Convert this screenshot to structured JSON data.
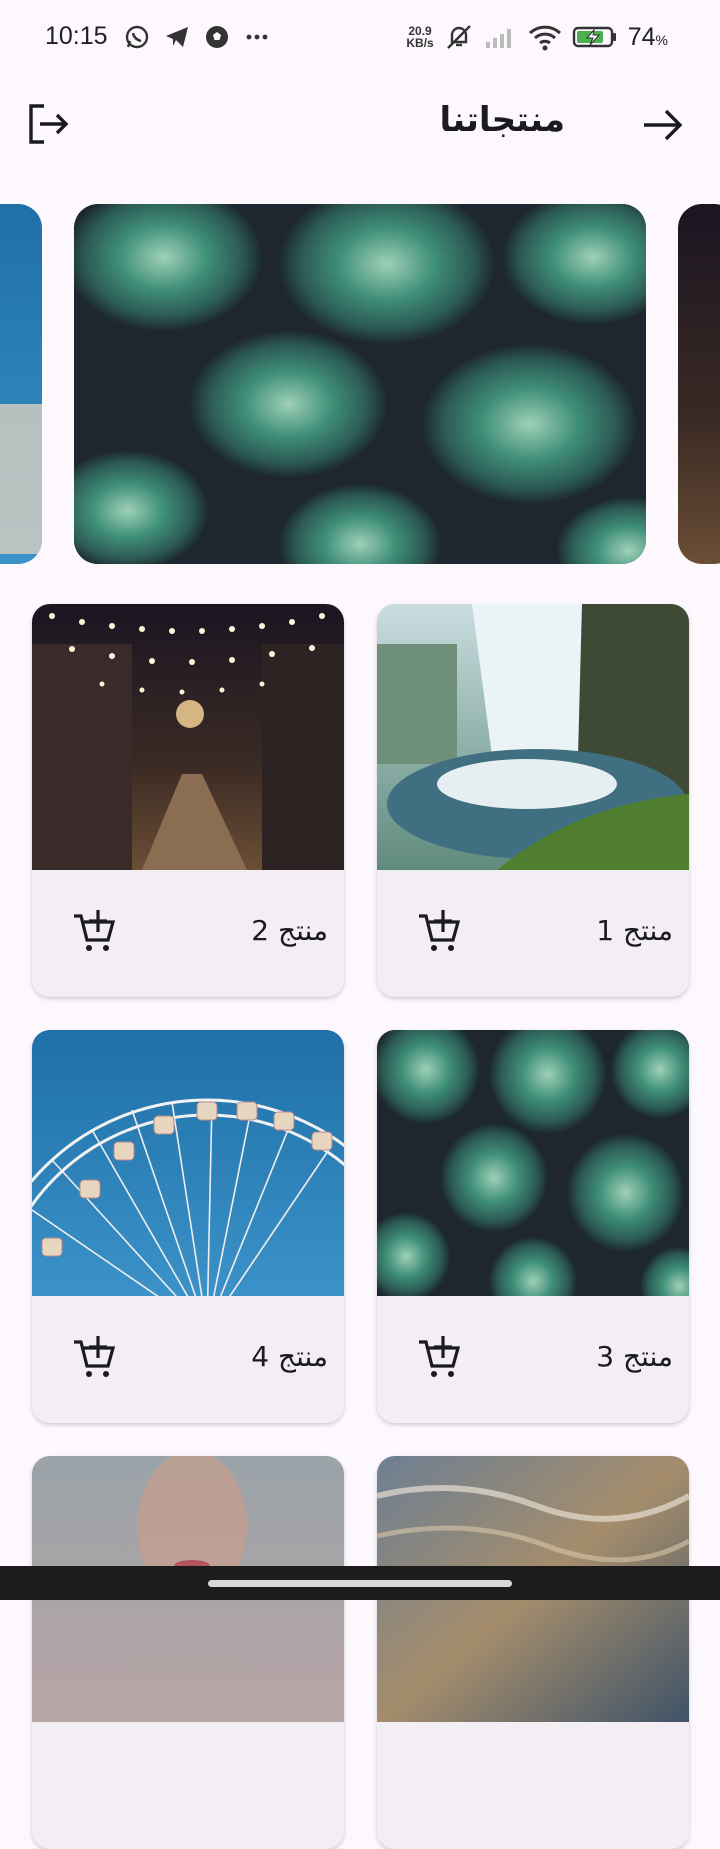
{
  "status_bar": {
    "time": "10:15",
    "left_icons": [
      "whatsapp-icon",
      "telegram-icon",
      "football-icon",
      "more-dots-icon"
    ],
    "net_speed_value": "20.9",
    "net_speed_unit": "KB/s",
    "right_icons": [
      "mute-icon",
      "signal-icon",
      "wifi-icon",
      "battery-charging-icon"
    ],
    "battery_percent": "74",
    "battery_symbol": "%"
  },
  "app_bar": {
    "title": "منتجاتنا",
    "back_icon": "arrow-right-icon",
    "logout_icon": "logout-icon"
  },
  "carousel": {
    "slides": [
      "waterfall",
      "succulents",
      "street-lights"
    ],
    "active_index": 1
  },
  "products": [
    {
      "label": "منتج 1",
      "image": "waterfall"
    },
    {
      "label": "منتج 2",
      "image": "street-lights"
    },
    {
      "label": "منتج 3",
      "image": "succulents"
    },
    {
      "label": "منتج 4",
      "image": "ferris-wheel"
    },
    {
      "label": "",
      "image": "ocean-water"
    },
    {
      "label": "",
      "image": "woman-portrait"
    }
  ],
  "colors": {
    "background": "#fdf7fe",
    "card": "#f3eef4",
    "icon": "#1b1b1f"
  }
}
